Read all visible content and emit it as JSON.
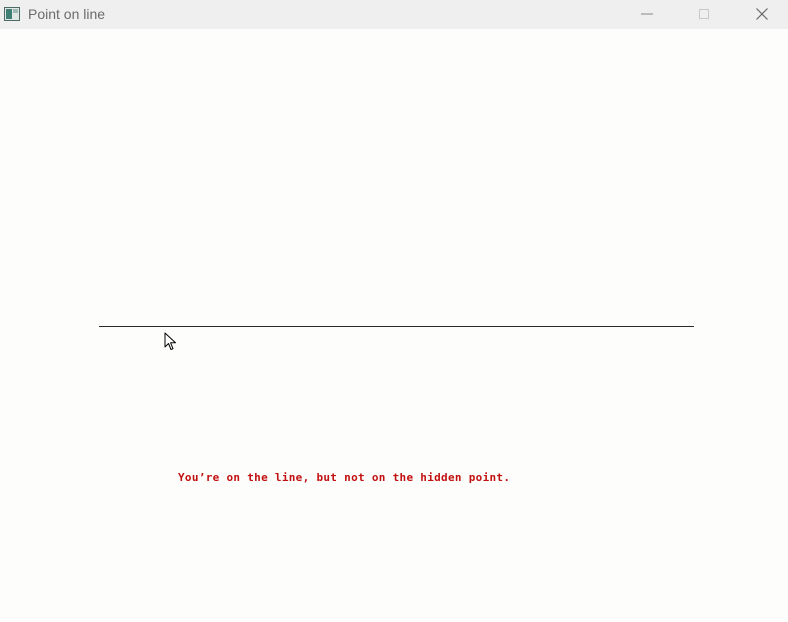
{
  "window": {
    "title": "Point on line",
    "icon": "app-window-icon",
    "controls": {
      "minimize_icon": "minimize-icon",
      "maximize_icon": "maximize-icon",
      "close_icon": "close-icon"
    }
  },
  "canvas": {
    "status_message": "You’re on the line, but not on the hidden point.",
    "colors": {
      "background": "#fdfdfb",
      "line": "#2a2a2a",
      "message": "#c21010"
    }
  }
}
